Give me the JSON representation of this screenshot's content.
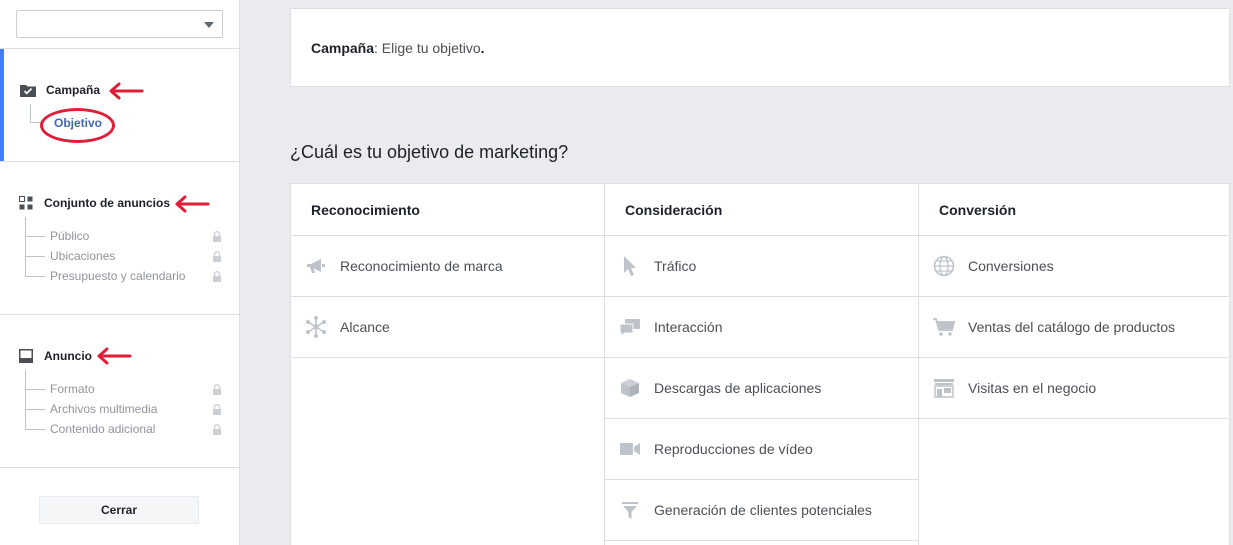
{
  "sidebar": {
    "dropdown_value": "",
    "campaign": {
      "label": "Campaña",
      "sub_label": "Objetivo"
    },
    "adset": {
      "label": "Conjunto de anuncios",
      "items": [
        {
          "label": "Público"
        },
        {
          "label": "Ubicaciones"
        },
        {
          "label": "Presupuesto y calendario"
        }
      ]
    },
    "ad": {
      "label": "Anuncio",
      "items": [
        {
          "label": "Formato"
        },
        {
          "label": "Archivos multimedia"
        },
        {
          "label": "Contenido adicional"
        }
      ]
    },
    "close_label": "Cerrar"
  },
  "header": {
    "strong": "Campaña",
    "rest": ": Elige tu objetivo",
    "period": "."
  },
  "question": "¿Cuál es tu objetivo de marketing?",
  "columns": [
    {
      "title": "Reconocimiento",
      "items": [
        {
          "label": "Reconocimiento de marca",
          "icon": "megaphone-icon"
        },
        {
          "label": "Alcance",
          "icon": "reach-icon"
        }
      ]
    },
    {
      "title": "Consideración",
      "items": [
        {
          "label": "Tráfico",
          "icon": "cursor-icon"
        },
        {
          "label": "Interacción",
          "icon": "chat-bubbles-icon"
        },
        {
          "label": "Descargas de aplicaciones",
          "icon": "box-icon"
        },
        {
          "label": "Reproducciones de vídeo",
          "icon": "video-camera-icon"
        },
        {
          "label": "Generación de clientes potenciales",
          "icon": "funnel-icon"
        }
      ]
    },
    {
      "title": "Conversión",
      "items": [
        {
          "label": "Conversiones",
          "icon": "globe-icon"
        },
        {
          "label": "Ventas del catálogo de productos",
          "icon": "cart-icon"
        },
        {
          "label": "Visitas en el negocio",
          "icon": "store-icon"
        }
      ]
    }
  ],
  "colors": {
    "accent": "#4080ff",
    "link": "#4267b2",
    "annotation_red": "#e01e37",
    "icon_gray": "#bec3c9"
  }
}
